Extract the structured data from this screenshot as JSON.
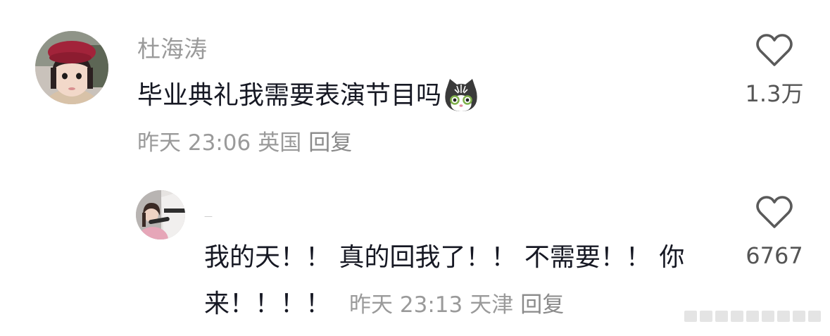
{
  "comment": {
    "username": "杜海涛",
    "text": "毕业典礼我需要表演节目吗",
    "emoji": "cat-emoji",
    "time": "昨天 23:06",
    "location": "英国",
    "reply_label": "回复",
    "like_count": "1.3万",
    "like_icon": "heart-outline-icon"
  },
  "reply": {
    "author": "—",
    "text_line1": "我的天！！ 真的回我了！！ 不需要！！ 你",
    "text_line2": "来！！！！",
    "time": "昨天 23:13",
    "location": "天津",
    "reply_label": "回复",
    "like_count": "6767",
    "like_icon": "heart-outline-icon"
  },
  "colors": {
    "primary_text": "#161823",
    "secondary_text": "#9a9a9a",
    "count_text": "#555555",
    "background": "#ffffff"
  }
}
